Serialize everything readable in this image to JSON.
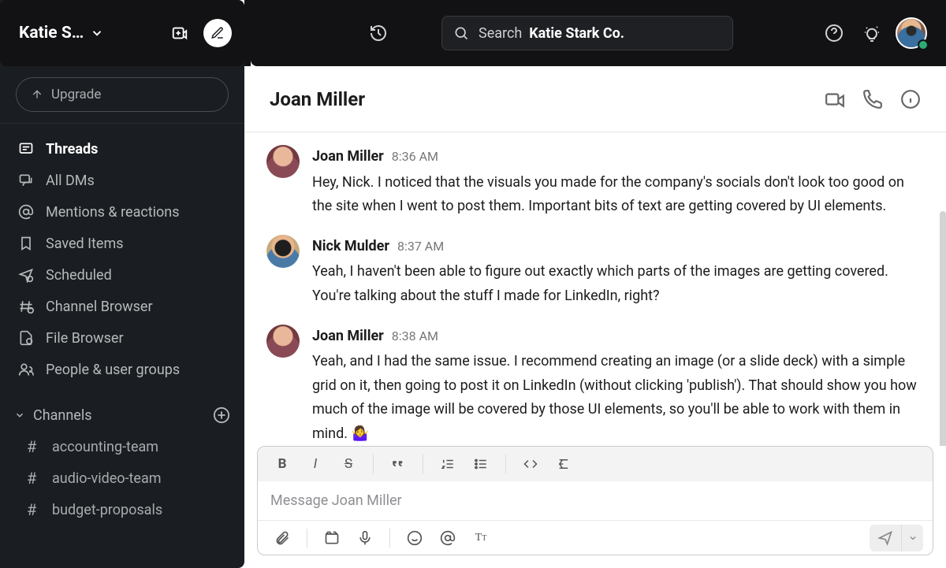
{
  "workspace": {
    "name": "Katie S…"
  },
  "sidebar": {
    "upgrade": "Upgrade",
    "items": [
      {
        "label": "Threads",
        "icon": "thread"
      },
      {
        "label": "All DMs",
        "icon": "dm"
      },
      {
        "label": "Mentions & reactions",
        "icon": "at"
      },
      {
        "label": "Saved Items",
        "icon": "bookmark"
      },
      {
        "label": "Scheduled",
        "icon": "scheduled"
      },
      {
        "label": "Channel Browser",
        "icon": "channel-browser"
      },
      {
        "label": "File Browser",
        "icon": "file-browser"
      },
      {
        "label": "People & user groups",
        "icon": "people"
      }
    ],
    "channels_header": "Channels",
    "channels": [
      {
        "name": "accounting-team"
      },
      {
        "name": "audio-video-team"
      },
      {
        "name": "budget-proposals"
      }
    ]
  },
  "search": {
    "prefix": "Search",
    "scope": "Katie Stark Co."
  },
  "conversation": {
    "title": "Joan Miller",
    "messages": [
      {
        "author": "Joan Miller",
        "avatar": "joan",
        "time": "8:36 AM",
        "text": "Hey, Nick. I noticed that the visuals you made for the company's socials don't look too good on the site when I went to post them. Important bits of text are getting covered by UI elements."
      },
      {
        "author": "Nick Mulder",
        "avatar": "nick",
        "time": "8:37 AM",
        "text": "Yeah, I haven't been able to figure out exactly which parts of the images are getting covered. You're talking about the stuff I made for LinkedIn, right?"
      },
      {
        "author": "Joan Miller",
        "avatar": "joan",
        "time": "8:38 AM",
        "text": "Yeah, and I had the same issue. I recommend creating an image (or a slide deck) with a simple grid on it, then going to post it on LinkedIn (without clicking 'publish'). That should show you how much of the image will be covered by those UI elements, so you'll be able to work with them in mind. 🤷‍♀️"
      }
    ]
  },
  "composer": {
    "placeholder": "Message Joan Miller"
  }
}
